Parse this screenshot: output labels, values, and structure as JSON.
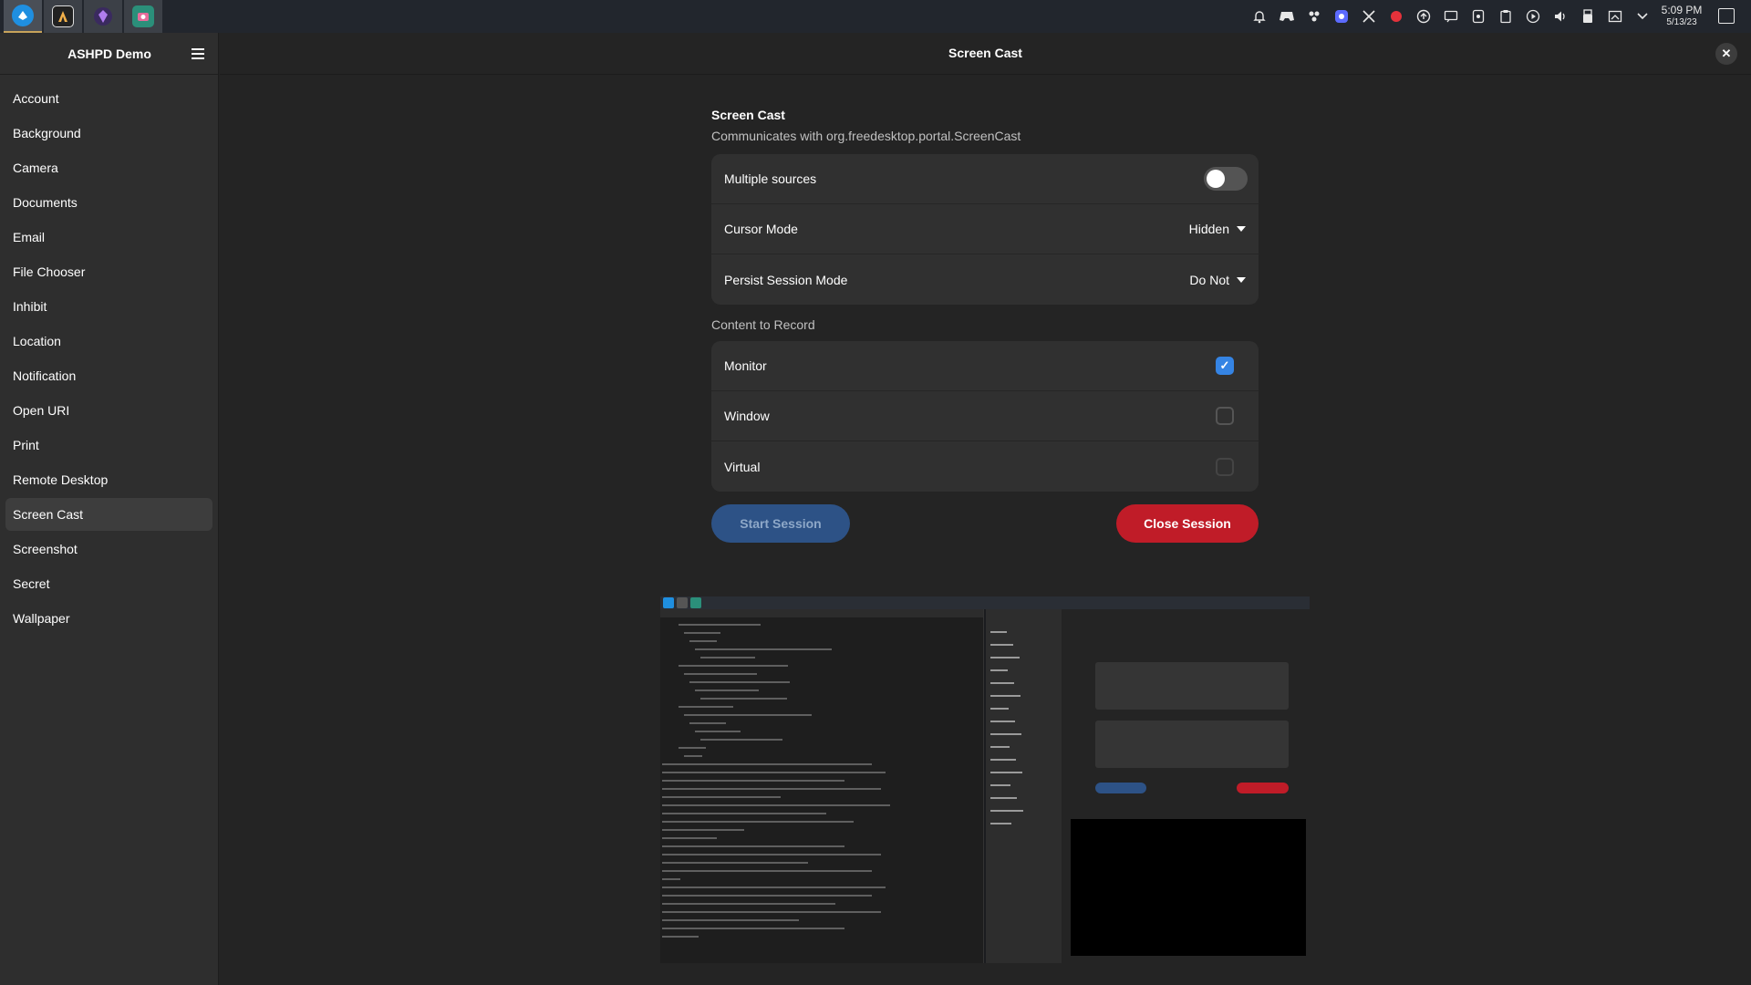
{
  "taskbar": {
    "apps": [
      {
        "icon": "thunderbird-icon",
        "color": "#1f8fe0",
        "state": "active"
      },
      {
        "icon": "inkscape-icon",
        "color": "#222222",
        "state": "open"
      },
      {
        "icon": "gem-app-icon",
        "color": "#7b3fbf",
        "state": "open"
      },
      {
        "icon": "screenshot-app-icon",
        "color": "#2b8f7a",
        "state": "open"
      }
    ],
    "tray_icons": [
      "notification-bell-icon",
      "gamepad-icon",
      "people-icon",
      "app-tray-icon",
      "tools-icon",
      "record-icon",
      "upload-icon",
      "messages-icon",
      "vpn-icon",
      "clipboard-icon",
      "media-play-icon",
      "volume-icon",
      "usb-icon",
      "network-icon",
      "chevron-down-icon"
    ],
    "clock_time": "5:09 PM",
    "clock_date": "5/13/23"
  },
  "sidebar": {
    "title": "ASHPD Demo",
    "items": [
      {
        "label": "Account"
      },
      {
        "label": "Background"
      },
      {
        "label": "Camera"
      },
      {
        "label": "Documents"
      },
      {
        "label": "Email"
      },
      {
        "label": "File Chooser"
      },
      {
        "label": "Inhibit"
      },
      {
        "label": "Location"
      },
      {
        "label": "Notification"
      },
      {
        "label": "Open URI"
      },
      {
        "label": "Print"
      },
      {
        "label": "Remote Desktop"
      },
      {
        "label": "Screen Cast",
        "selected": true
      },
      {
        "label": "Screenshot"
      },
      {
        "label": "Secret"
      },
      {
        "label": "Wallpaper"
      }
    ]
  },
  "header": {
    "title": "Screen Cast",
    "close_label": "✕"
  },
  "main": {
    "section_title": "Screen Cast",
    "section_subtitle": "Communicates with org.freedesktop.portal.ScreenCast",
    "settings": {
      "multiple_sources_label": "Multiple sources",
      "multiple_sources_on": false,
      "cursor_mode_label": "Cursor Mode",
      "cursor_mode_value": "Hidden",
      "persist_label": "Persist Session Mode",
      "persist_value": "Do Not"
    },
    "content_label": "Content to Record",
    "content_options": [
      {
        "label": "Monitor",
        "checked": true
      },
      {
        "label": "Window",
        "checked": false
      },
      {
        "label": "Virtual",
        "checked": false
      }
    ],
    "start_label": "Start Session",
    "close_session_label": "Close Session"
  },
  "colors": {
    "accent": "#3584e4",
    "destructive": "#c01c28",
    "suggested_disabled": "#2d5286"
  }
}
